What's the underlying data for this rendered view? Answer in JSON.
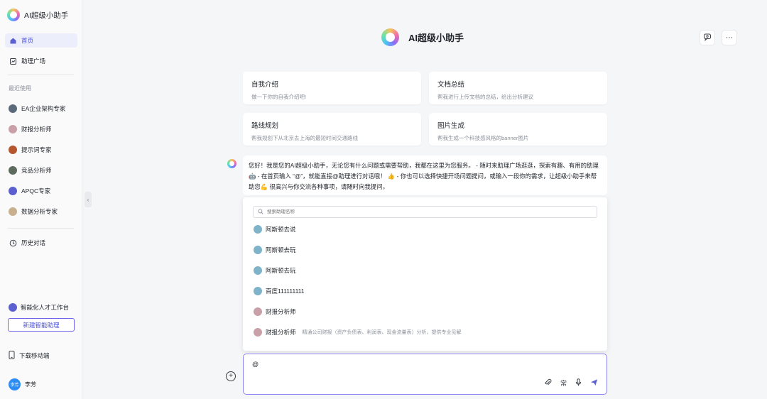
{
  "app": {
    "brand_name": "AI超级小助手"
  },
  "sidebar": {
    "nav": [
      {
        "label": "首页",
        "icon": "home-icon",
        "active": true
      },
      {
        "label": "助理广场",
        "icon": "square-icon",
        "active": false
      }
    ],
    "recent_label": "最近使用",
    "recent": [
      {
        "label": "EA企业架构专家",
        "icon": "avatar-icon",
        "color": "#5a6a7a"
      },
      {
        "label": "财报分析师",
        "icon": "avatar-icon",
        "color": "#c9a0a8"
      },
      {
        "label": "提示词专家",
        "icon": "avatar-icon",
        "color": "#b5562f"
      },
      {
        "label": "竞品分析师",
        "icon": "avatar-icon",
        "color": "#5d6b5f"
      },
      {
        "label": "APQC专家",
        "icon": "avatar-icon",
        "color": "#5b5fd0"
      },
      {
        "label": "数据分析专家",
        "icon": "avatar-icon",
        "color": "#c8b08e"
      }
    ],
    "history_label": "历史对话",
    "workbench_label": "智能化人才工作台",
    "new_assistant_label": "新建智能助理",
    "download_label": "下载移动端",
    "user": {
      "avatar_text": "李芳",
      "name": "李芳"
    }
  },
  "main": {
    "title": "AI超级小助手",
    "cards": [
      {
        "title": "自我介绍",
        "desc": "做一下你的自我介绍吧!"
      },
      {
        "title": "文档总结",
        "desc": "帮我进行上传文档的总结，给出分析建议"
      },
      {
        "title": "路线规划",
        "desc": "帮我规划下从北京去上海的最短时间交通路线"
      },
      {
        "title": "图片生成",
        "desc": "帮我生成一个科技感风格的banner图片"
      }
    ],
    "message": "您好！我是您的AI超级小助手，无论您有什么问题或需要帮助，我都在这里为您服务。 - 随时来助理广场逛逛，探索有趣、有用的助理🤖 - 在首页输入 “@”，就能直接@助理进行对话哦！ 👍 - 你也可以选择快捷开场问题提问，或输入一段你的需求，让超级小助手来帮助您💪 很高兴与你交流各种事项，请随时向我提问。",
    "mention_popup": {
      "search_placeholder": "搜索助理名称",
      "items": [
        {
          "name": "阿斯顿去说",
          "desc": "",
          "color": "#7fb3c9"
        },
        {
          "name": "阿斯顿去玩",
          "desc": "",
          "color": "#7fb3c9"
        },
        {
          "name": "阿斯顿去玩",
          "desc": "",
          "color": "#7fb3c9"
        },
        {
          "name": "百度111111111",
          "desc": "",
          "color": "#7fb3c9"
        },
        {
          "name": "财报分析师",
          "desc": "",
          "color": "#c9a0a8"
        },
        {
          "name": "财报分析师",
          "desc": "精通公司财报（资产负债表、利润表、现金流量表）分析，提供专业见解",
          "color": "#c9a0a8"
        }
      ]
    },
    "composer": {
      "value": "@",
      "common_label": "常"
    }
  }
}
